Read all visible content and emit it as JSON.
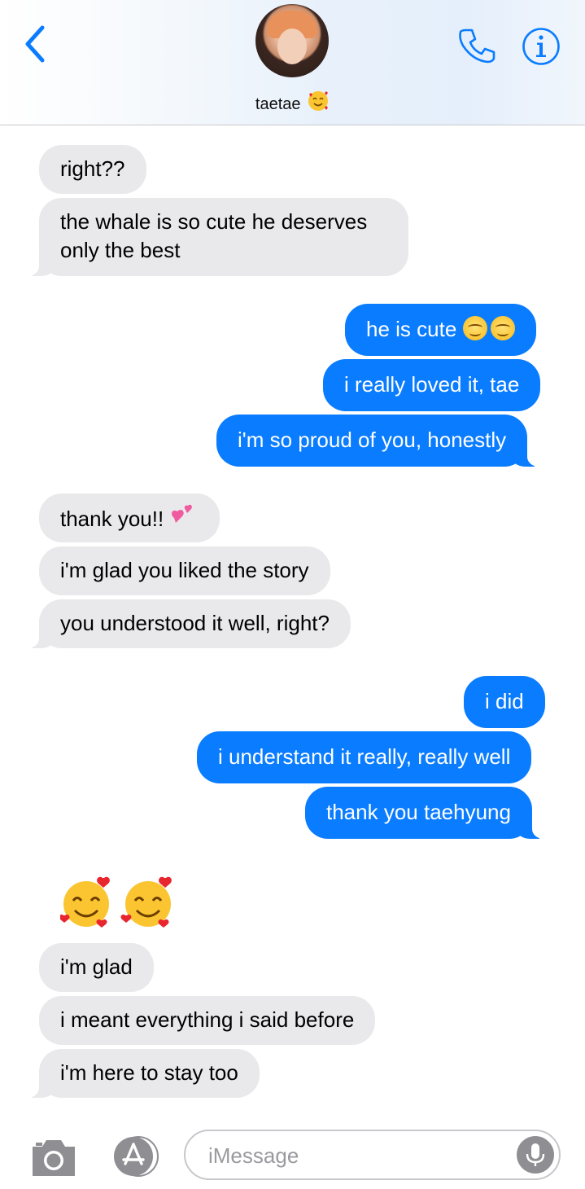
{
  "header": {
    "contact_name": "taetae",
    "contact_emoji": "smiling-face-with-hearts-icon"
  },
  "messages": [
    {
      "from": "them",
      "text": "right??"
    },
    {
      "from": "them",
      "text": "the whale is so cute he deserves only the best"
    },
    {
      "from": "me",
      "text": "he is cute",
      "emoji": "smiling-face-icon x2"
    },
    {
      "from": "me",
      "text": "i really loved it, tae"
    },
    {
      "from": "me",
      "text": "i'm so proud of you, honestly"
    },
    {
      "from": "them",
      "text": "thank you!!",
      "emoji": "two-hearts-icon"
    },
    {
      "from": "them",
      "text": "i'm glad you liked the story"
    },
    {
      "from": "them",
      "text": "you understood it well, right?"
    },
    {
      "from": "me",
      "text": "i did"
    },
    {
      "from": "me",
      "text": "i understand it really, really well"
    },
    {
      "from": "me",
      "text": "thank you taehyung"
    },
    {
      "from": "them",
      "emoji": "smiling-face-with-hearts-icon x2"
    },
    {
      "from": "them",
      "text": "i'm glad"
    },
    {
      "from": "them",
      "text": "i meant everything i said before"
    },
    {
      "from": "them",
      "text": "i'm here to stay too"
    }
  ],
  "input": {
    "placeholder": "iMessage"
  },
  "colors": {
    "accent": "#0a7cff",
    "incoming_bubble": "#e9e9eb",
    "nav_icon": "#0a7cff"
  }
}
